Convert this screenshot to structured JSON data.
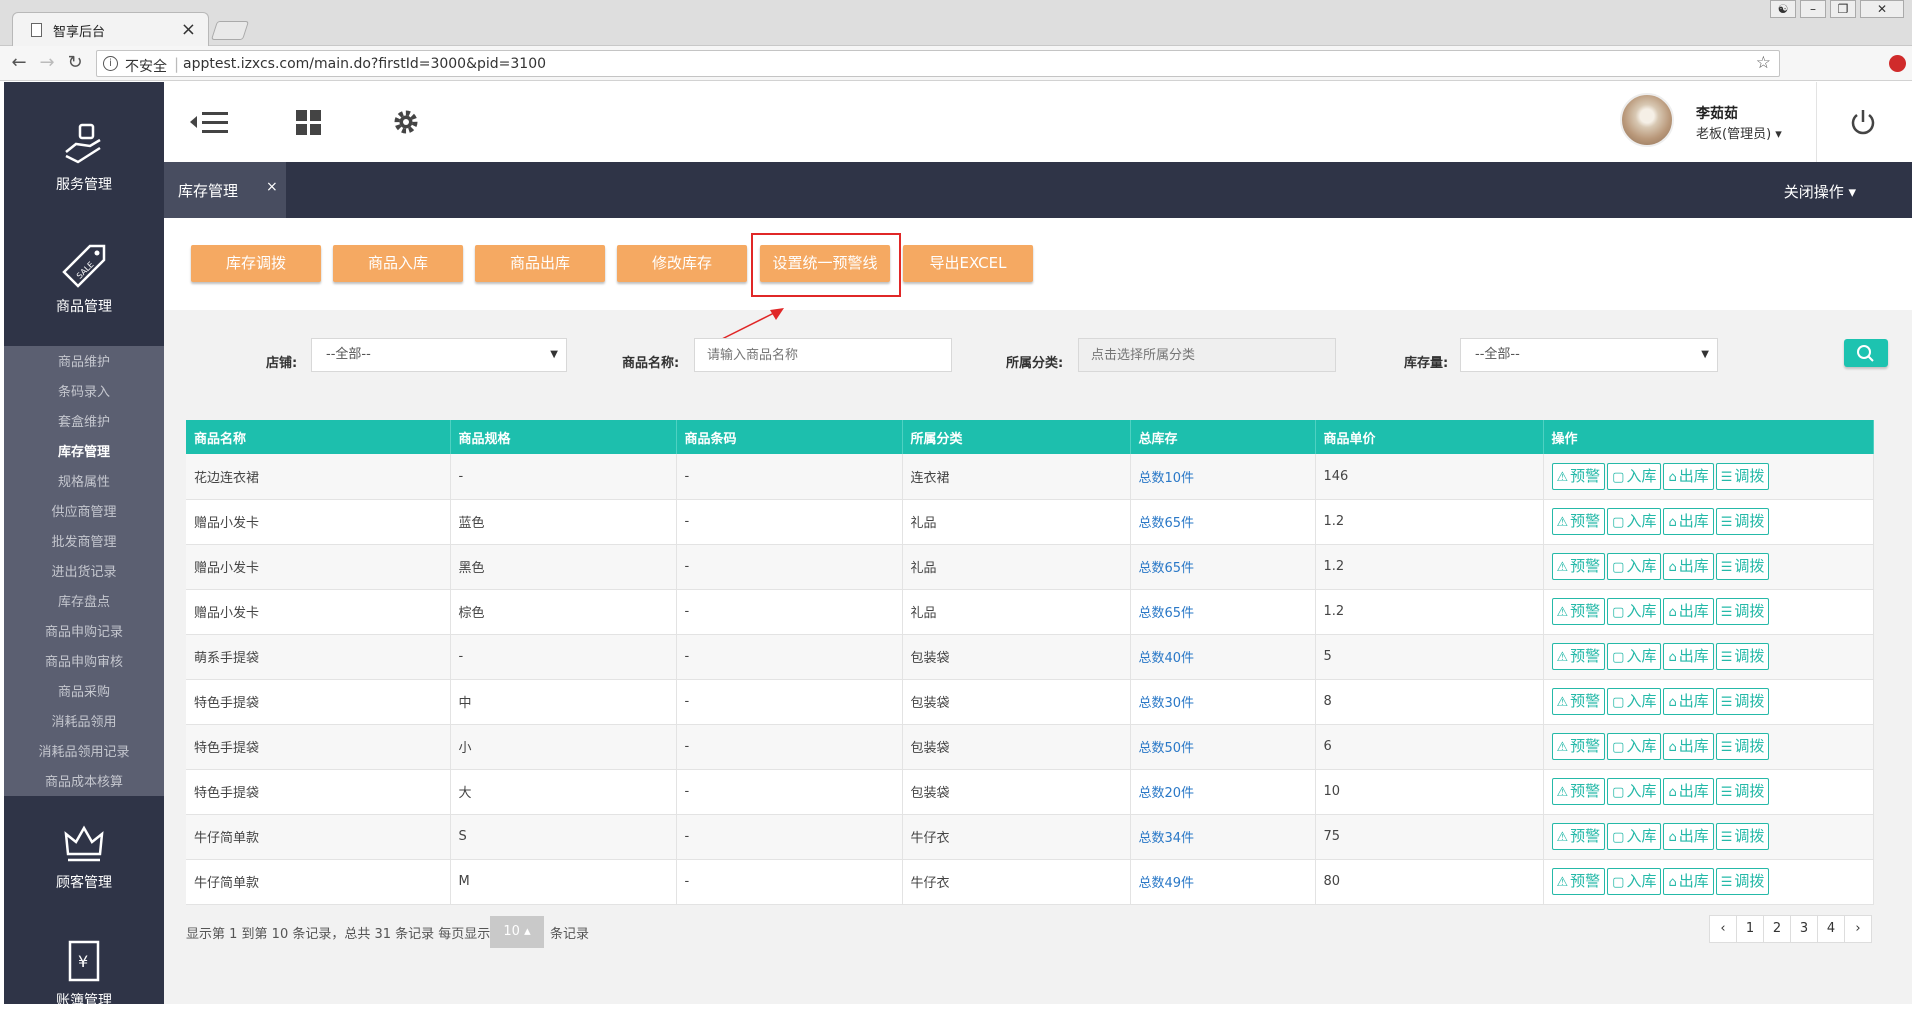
{
  "browser": {
    "tab_title": "智享后台",
    "tab_close": "×",
    "insecure_label": "不安全",
    "url": "apptest.izxcs.com/main.do?firstId=3000&pid=3100"
  },
  "left_nav": {
    "modules": [
      "服务管理",
      "商品管理",
      "顾客管理",
      "账簿管理"
    ],
    "submenu": [
      "商品维护",
      "条码录入",
      "套盒维护",
      "库存管理",
      "规格属性",
      "供应商管理",
      "批发商管理",
      "进出货记录",
      "库存盘点",
      "商品申购记录",
      "商品申购审核",
      "商品采购",
      "消耗品领用",
      "消耗品领用记录",
      "商品成本核算"
    ],
    "active_item": "库存管理"
  },
  "header": {
    "user_name": "李茹茹",
    "user_role": "老板(管理员) ▾"
  },
  "tabbar": {
    "tab_label": "库存管理",
    "tab_close": "×",
    "close_ops": "关闭操作 ▾"
  },
  "toolbar": {
    "buttons": [
      "库存调拨",
      "商品入库",
      "商品出库",
      "修改库存",
      "设置统一预警线",
      "导出EXCEL"
    ]
  },
  "filters": {
    "store_label": "店铺:",
    "store_value": "--全部--",
    "name_label": "商品名称:",
    "name_placeholder": "请输入商品名称",
    "category_label": "所属分类:",
    "category_placeholder": "点击选择所属分类",
    "stock_label": "库存量:",
    "stock_value": "--全部--"
  },
  "table": {
    "headers": [
      "商品名称",
      "商品规格",
      "商品条码",
      "所属分类",
      "总库存",
      "商品单价",
      "操作"
    ],
    "actions": [
      "预警",
      "入库",
      "出库",
      "调拨"
    ],
    "rows": [
      {
        "name": "花边连衣裙",
        "spec": "-",
        "barcode": "-",
        "category": "连衣裙",
        "stock": "总数10件",
        "price": "146"
      },
      {
        "name": "赠品小发卡",
        "spec": "蓝色",
        "barcode": "-",
        "category": "礼品",
        "stock": "总数65件",
        "price": "1.2"
      },
      {
        "name": "赠品小发卡",
        "spec": "黑色",
        "barcode": "-",
        "category": "礼品",
        "stock": "总数65件",
        "price": "1.2"
      },
      {
        "name": "赠品小发卡",
        "spec": "棕色",
        "barcode": "-",
        "category": "礼品",
        "stock": "总数65件",
        "price": "1.2"
      },
      {
        "name": "萌系手提袋",
        "spec": "-",
        "barcode": "-",
        "category": "包装袋",
        "stock": "总数40件",
        "price": "5"
      },
      {
        "name": "特色手提袋",
        "spec": "中",
        "barcode": "-",
        "category": "包装袋",
        "stock": "总数30件",
        "price": "8"
      },
      {
        "name": "特色手提袋",
        "spec": "小",
        "barcode": "-",
        "category": "包装袋",
        "stock": "总数50件",
        "price": "6"
      },
      {
        "name": "特色手提袋",
        "spec": "大",
        "barcode": "-",
        "category": "包装袋",
        "stock": "总数20件",
        "price": "10"
      },
      {
        "name": "牛仔简单款",
        "spec": "S",
        "barcode": "-",
        "category": "牛仔衣",
        "stock": "总数34件",
        "price": "75"
      },
      {
        "name": "牛仔简单款",
        "spec": "M",
        "barcode": "-",
        "category": "牛仔衣",
        "stock": "总数49件",
        "price": "80"
      }
    ]
  },
  "pagination": {
    "info": "显示第 1 到第 10 条记录，总共 31 条记录 每页显示",
    "page_size": "10 ▴",
    "suffix": "条记录",
    "prev": "‹",
    "pages": [
      "1",
      "2",
      "3",
      "4"
    ],
    "next": "›"
  },
  "colors": {
    "accent_teal": "#1dbfad",
    "orange_button": "#f5a962",
    "sidebar_dark": "#2f3447",
    "highlight_red": "#e02727",
    "link_blue": "#2a78c7"
  }
}
